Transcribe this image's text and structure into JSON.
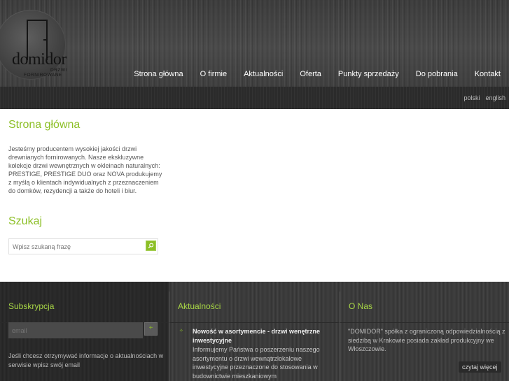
{
  "brand": {
    "logo_text": "domidor",
    "logo_sub1": "DRZWI",
    "logo_sub2": "FORNIROWANE"
  },
  "nav": {
    "items": [
      "Strona główna",
      "O firmie",
      "Aktualności",
      "Oferta",
      "Punkty sprzedaży",
      "Do pobrania",
      "Kontakt"
    ]
  },
  "languages": [
    "polski",
    "english"
  ],
  "main": {
    "title": "Strona główna",
    "intro": "Jesteśmy producentem wysokiej jakości drzwi drewnianych fornirowanych. Nasze ekskluzywne kolekcje drzwi wewnętrznych w okleinach naturalnych: PRESTIGE, PRESTIGE DUO oraz NOVA produkujemy z myślą o klientach indywidualnych z przeznaczeniem do domków, rezydencji a także do hoteli i biur."
  },
  "search": {
    "title": "Szukaj",
    "placeholder": "Wpisz szukaną frazę"
  },
  "footer": {
    "subscription": {
      "title": "Subskrypcja",
      "email_placeholder": "email",
      "button_label": "+",
      "text": "Jeśli chcesz otrzymywać informacje o aktualnościach w serwisie wpisz swój email"
    },
    "news": {
      "title": "Aktualności",
      "item_title": "Nowość w asortymencie - drzwi wenętrzne inwestycyjne",
      "item_body": "Informujemy Państwa o poszerzeniu naszego asortymentu o drzwi wewnątrzlokalowe inwestycyjne przeznaczone do stosowania w budownictwie mieszkaniowym"
    },
    "about": {
      "title": "O Nas",
      "text": "\"DOMIDOR\" spółka z ograniczoną odpowiedzialnością z siedzibą w Krakowie posiada zakład produkcyjny we Włoszczowie.",
      "more_label": "czytaj więcej"
    }
  },
  "colors": {
    "accent": "#8cbf26",
    "footer_heading": "#a8d646",
    "header_bg": "#454545",
    "footer_bg": "#3b3b3b"
  }
}
